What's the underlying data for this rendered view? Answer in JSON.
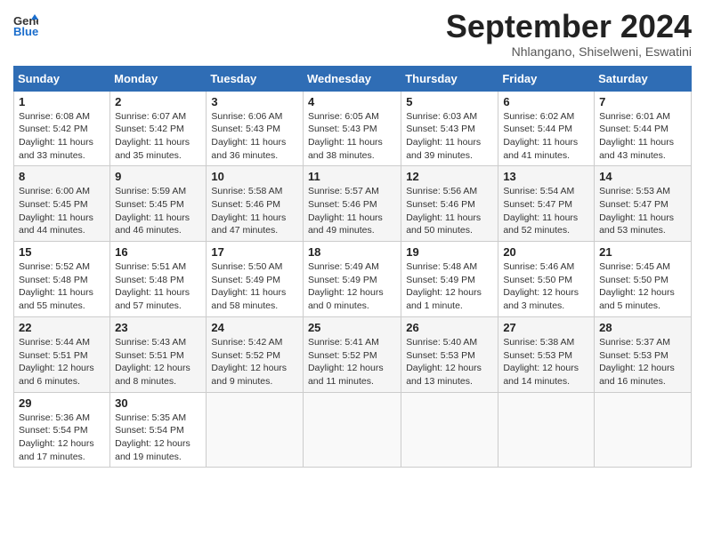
{
  "header": {
    "logo_general": "General",
    "logo_blue": "Blue",
    "month_title": "September 2024",
    "location": "Nhlangano, Shiselweni, Eswatini"
  },
  "weekdays": [
    "Sunday",
    "Monday",
    "Tuesday",
    "Wednesday",
    "Thursday",
    "Friday",
    "Saturday"
  ],
  "weeks": [
    [
      {
        "day": 1,
        "sunrise": "6:08 AM",
        "sunset": "5:42 PM",
        "daylight": "11 hours and 33 minutes."
      },
      {
        "day": 2,
        "sunrise": "6:07 AM",
        "sunset": "5:42 PM",
        "daylight": "11 hours and 35 minutes."
      },
      {
        "day": 3,
        "sunrise": "6:06 AM",
        "sunset": "5:43 PM",
        "daylight": "11 hours and 36 minutes."
      },
      {
        "day": 4,
        "sunrise": "6:05 AM",
        "sunset": "5:43 PM",
        "daylight": "11 hours and 38 minutes."
      },
      {
        "day": 5,
        "sunrise": "6:03 AM",
        "sunset": "5:43 PM",
        "daylight": "11 hours and 39 minutes."
      },
      {
        "day": 6,
        "sunrise": "6:02 AM",
        "sunset": "5:44 PM",
        "daylight": "11 hours and 41 minutes."
      },
      {
        "day": 7,
        "sunrise": "6:01 AM",
        "sunset": "5:44 PM",
        "daylight": "11 hours and 43 minutes."
      }
    ],
    [
      {
        "day": 8,
        "sunrise": "6:00 AM",
        "sunset": "5:45 PM",
        "daylight": "11 hours and 44 minutes."
      },
      {
        "day": 9,
        "sunrise": "5:59 AM",
        "sunset": "5:45 PM",
        "daylight": "11 hours and 46 minutes."
      },
      {
        "day": 10,
        "sunrise": "5:58 AM",
        "sunset": "5:46 PM",
        "daylight": "11 hours and 47 minutes."
      },
      {
        "day": 11,
        "sunrise": "5:57 AM",
        "sunset": "5:46 PM",
        "daylight": "11 hours and 49 minutes."
      },
      {
        "day": 12,
        "sunrise": "5:56 AM",
        "sunset": "5:46 PM",
        "daylight": "11 hours and 50 minutes."
      },
      {
        "day": 13,
        "sunrise": "5:54 AM",
        "sunset": "5:47 PM",
        "daylight": "11 hours and 52 minutes."
      },
      {
        "day": 14,
        "sunrise": "5:53 AM",
        "sunset": "5:47 PM",
        "daylight": "11 hours and 53 minutes."
      }
    ],
    [
      {
        "day": 15,
        "sunrise": "5:52 AM",
        "sunset": "5:48 PM",
        "daylight": "11 hours and 55 minutes."
      },
      {
        "day": 16,
        "sunrise": "5:51 AM",
        "sunset": "5:48 PM",
        "daylight": "11 hours and 57 minutes."
      },
      {
        "day": 17,
        "sunrise": "5:50 AM",
        "sunset": "5:49 PM",
        "daylight": "11 hours and 58 minutes."
      },
      {
        "day": 18,
        "sunrise": "5:49 AM",
        "sunset": "5:49 PM",
        "daylight": "12 hours and 0 minutes."
      },
      {
        "day": 19,
        "sunrise": "5:48 AM",
        "sunset": "5:49 PM",
        "daylight": "12 hours and 1 minute."
      },
      {
        "day": 20,
        "sunrise": "5:46 AM",
        "sunset": "5:50 PM",
        "daylight": "12 hours and 3 minutes."
      },
      {
        "day": 21,
        "sunrise": "5:45 AM",
        "sunset": "5:50 PM",
        "daylight": "12 hours and 5 minutes."
      }
    ],
    [
      {
        "day": 22,
        "sunrise": "5:44 AM",
        "sunset": "5:51 PM",
        "daylight": "12 hours and 6 minutes."
      },
      {
        "day": 23,
        "sunrise": "5:43 AM",
        "sunset": "5:51 PM",
        "daylight": "12 hours and 8 minutes."
      },
      {
        "day": 24,
        "sunrise": "5:42 AM",
        "sunset": "5:52 PM",
        "daylight": "12 hours and 9 minutes."
      },
      {
        "day": 25,
        "sunrise": "5:41 AM",
        "sunset": "5:52 PM",
        "daylight": "12 hours and 11 minutes."
      },
      {
        "day": 26,
        "sunrise": "5:40 AM",
        "sunset": "5:53 PM",
        "daylight": "12 hours and 13 minutes."
      },
      {
        "day": 27,
        "sunrise": "5:38 AM",
        "sunset": "5:53 PM",
        "daylight": "12 hours and 14 minutes."
      },
      {
        "day": 28,
        "sunrise": "5:37 AM",
        "sunset": "5:53 PM",
        "daylight": "12 hours and 16 minutes."
      }
    ],
    [
      {
        "day": 29,
        "sunrise": "5:36 AM",
        "sunset": "5:54 PM",
        "daylight": "12 hours and 17 minutes."
      },
      {
        "day": 30,
        "sunrise": "5:35 AM",
        "sunset": "5:54 PM",
        "daylight": "12 hours and 19 minutes."
      },
      null,
      null,
      null,
      null,
      null
    ]
  ]
}
